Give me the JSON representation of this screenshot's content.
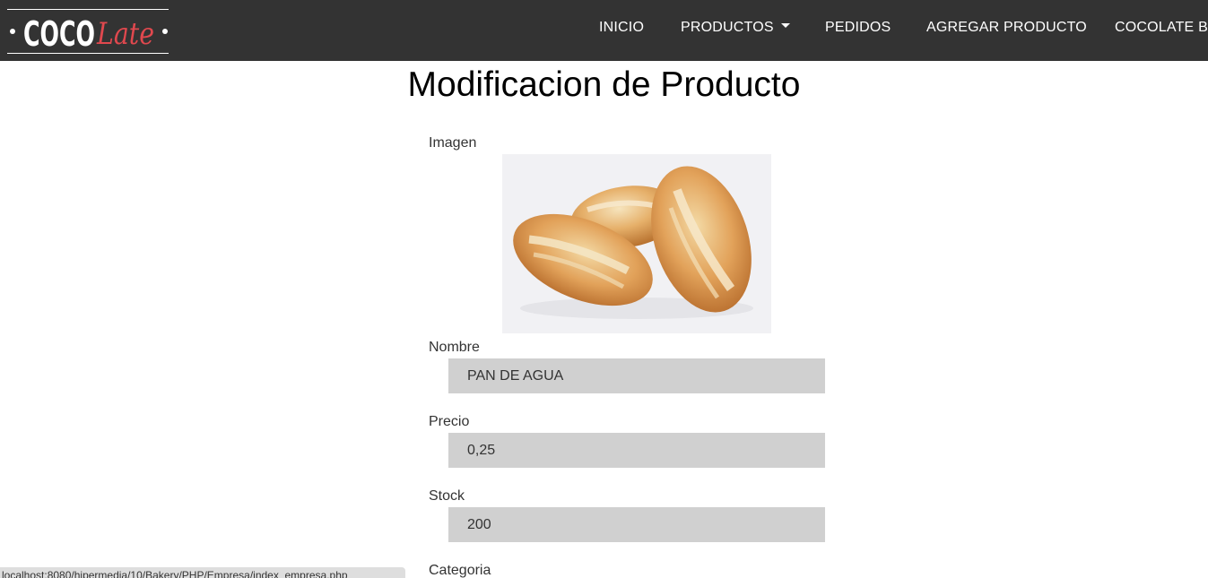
{
  "brand": {
    "logo_text": "COCOLate",
    "logo_part1": "COCO",
    "logo_part2": "Late"
  },
  "nav": {
    "items": [
      {
        "label": "INICIO"
      },
      {
        "label": "PRODUCTOS",
        "has_dropdown": true
      },
      {
        "label": "PEDIDOS"
      },
      {
        "label": "AGREGAR PRODUCTO"
      },
      {
        "label": "COCOLATE BA"
      }
    ]
  },
  "page": {
    "title": "Modificacion de Producto"
  },
  "form": {
    "image_label": "Imagen",
    "image_subject": "bread-rolls",
    "name_label": "Nombre",
    "name_value": "PAN DE AGUA",
    "price_label": "Precio",
    "price_value": "0,25",
    "stock_label": "Stock",
    "stock_value": "200",
    "category_label": "Categoria"
  },
  "status_bar": {
    "url": "localhost:8080/hipermedia/10/Bakery/PHP/Empresa/index_empresa.php"
  },
  "colors": {
    "navbar_bg": "#333333",
    "logo_accent": "#e0484e",
    "input_bg": "#d0d0d0"
  }
}
